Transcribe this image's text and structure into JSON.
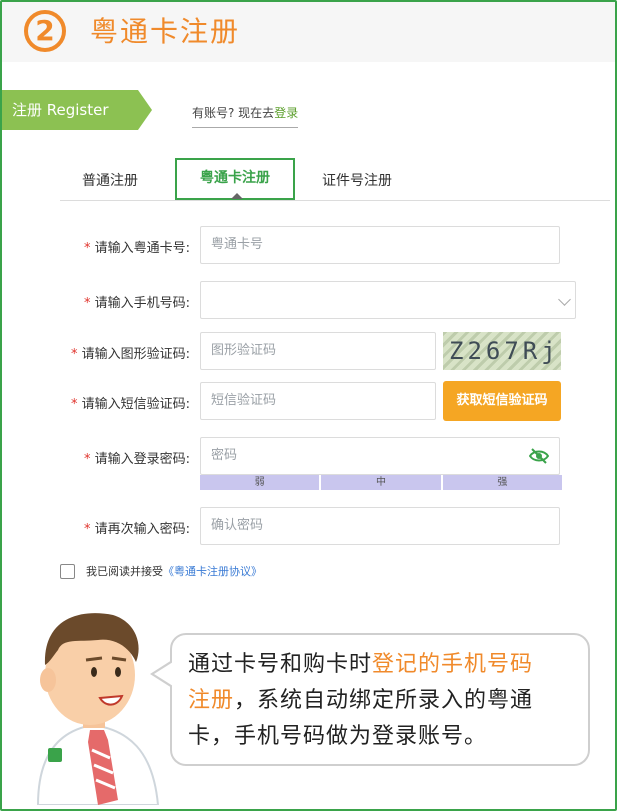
{
  "header": {
    "step": "2",
    "title": "粤通卡注册"
  },
  "ribbon": {
    "label": "注册 Register"
  },
  "login_hint": {
    "prefix": "有账号? 现在去",
    "link": "登录"
  },
  "tabs": [
    {
      "label": "普通注册"
    },
    {
      "label": "粤通卡注册"
    },
    {
      "label": "证件号注册"
    }
  ],
  "form": {
    "card": {
      "label": "请输入粤通卡号:",
      "placeholder": "粤通卡号"
    },
    "phone": {
      "label": "请输入手机号码:",
      "placeholder": ""
    },
    "captcha": {
      "label": "请输入图形验证码:",
      "placeholder": "图形验证码",
      "image_text": "Z267Rj"
    },
    "sms": {
      "label": "请输入短信验证码:",
      "placeholder": "短信验证码",
      "button": "获取短信验证码"
    },
    "password": {
      "label": "请输入登录密码:",
      "placeholder": "密码",
      "strength": [
        "弱",
        "中",
        "强"
      ]
    },
    "confirm": {
      "label": "请再次输入密码:",
      "placeholder": "确认密码"
    },
    "required_mark": "*"
  },
  "agree": {
    "prefix": "我已阅读并接受",
    "link": "《粤通卡注册协议》"
  },
  "bubble": {
    "line1_a": "通过卡号和购卡时",
    "line1_hl": "登记的手机号码",
    "line2_hl": "注册",
    "line2_b": "，系统自动绑定所录入的粤通",
    "line3": "卡，手机号码做为登录账号。"
  },
  "colors": {
    "brand_orange": "#f08a2b",
    "frame_green": "#3aa34a",
    "ribbon_green": "#8cc152",
    "button_orange": "#f5a623"
  },
  "icons": [
    "eye-slash-icon",
    "chevron-down-icon",
    "checkbox-icon"
  ]
}
